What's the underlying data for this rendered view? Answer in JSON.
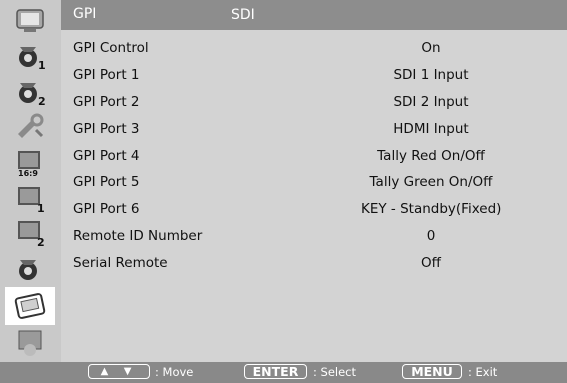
{
  "header": {
    "title": "GPI",
    "subtitle": "SDI"
  },
  "sidebar": {
    "items": [
      {
        "icon": "monitor-icon"
      },
      {
        "icon": "gear-1-icon"
      },
      {
        "icon": "gear-2-icon"
      },
      {
        "icon": "wrench-icon"
      },
      {
        "icon": "video-16-9-icon"
      },
      {
        "icon": "video-1-icon"
      },
      {
        "icon": "video-2-icon"
      },
      {
        "icon": "gear-icon"
      },
      {
        "icon": "gpi-port-icon",
        "active": true
      },
      {
        "icon": "info-icon"
      }
    ]
  },
  "menu": {
    "rows": [
      {
        "label": "GPI Control",
        "value": "On"
      },
      {
        "label": "GPI Port 1",
        "value": "SDI 1 Input"
      },
      {
        "label": "GPI Port 2",
        "value": "SDI 2 Input"
      },
      {
        "label": "GPI Port 3",
        "value": "HDMI Input"
      },
      {
        "label": "GPI Port 4",
        "value": "Tally Red On/Off"
      },
      {
        "label": "GPI Port 5",
        "value": "Tally Green On/Off"
      },
      {
        "label": "GPI Port 6",
        "value": "KEY - Standby(Fixed)"
      },
      {
        "label": "Remote ID Number",
        "value": "0"
      },
      {
        "label": "Serial Remote",
        "value": "Off"
      }
    ]
  },
  "footer": {
    "move_key": "▲ ▼",
    "move_label": ": Move",
    "enter_key": "ENTER",
    "enter_label": ": Select",
    "menu_key": "MENU",
    "menu_label": ": Exit"
  },
  "colors": {
    "sidebar": "#c9c9c9",
    "panel": "#d3d3d3",
    "header": "#8d8d8d",
    "footer": "#898989",
    "active_item": "#ffffff"
  }
}
